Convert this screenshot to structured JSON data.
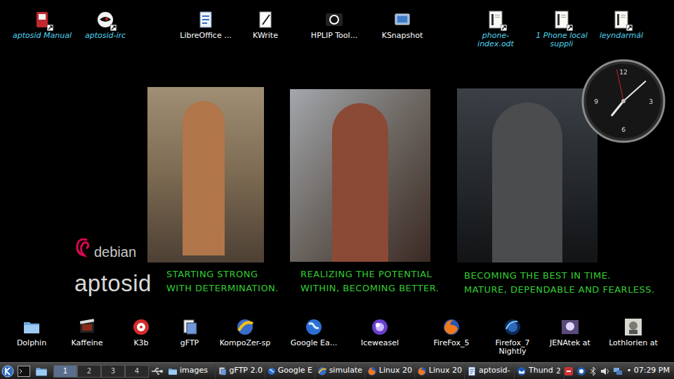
{
  "desktop_icons_top": [
    {
      "label": "aptosid Manual",
      "link": true
    },
    {
      "label": "aptosid-irc",
      "link": true
    },
    {
      "label": "LibreOffice ...",
      "link": false
    },
    {
      "label": "KWrite",
      "link": false
    },
    {
      "label": "HPLIP Tool...",
      "link": false
    },
    {
      "label": "KSnapshot",
      "link": false
    },
    {
      "label": "phone-index.odt",
      "link": true
    },
    {
      "label": "1 Phone local suppli",
      "link": true
    },
    {
      "label": "leyndarmál",
      "link": true
    }
  ],
  "photos": [
    {
      "caption": [
        "STARTING STRONG",
        "WITH DETERMINATION."
      ]
    },
    {
      "caption": [
        "REALIZING THE POTENTIAL",
        "WITHIN, BECOMING BETTER."
      ]
    },
    {
      "caption": [
        "BECOMING THE BEST IN TIME.",
        "MATURE, DEPENDABLE AND FEARLESS."
      ]
    }
  ],
  "logo": {
    "debian": "debian",
    "aptosid": "aptosid"
  },
  "clock": {
    "numerals": [
      "12",
      "3",
      "6",
      "9"
    ],
    "hour": 7.3,
    "minute": 8,
    "second": 58
  },
  "desktop_icons_bottom": [
    {
      "label": "Dolphin"
    },
    {
      "label": "Kaffeine"
    },
    {
      "label": "K3b"
    },
    {
      "label": "gFTP"
    },
    {
      "label": "KompoZer-sp"
    },
    {
      "label": "Google Ea..."
    },
    {
      "label": "Iceweasel"
    },
    {
      "label": "FireFox_5"
    },
    {
      "label": "Firefox_7 Nightly"
    },
    {
      "label": "JENAtek at"
    },
    {
      "label": "Lothlorien at"
    }
  ],
  "taskbar": {
    "pager": [
      {
        "label": "1",
        "selected": true
      },
      {
        "label": "2",
        "selected": false
      },
      {
        "label": "3",
        "selected": false
      },
      {
        "label": "4",
        "selected": false
      }
    ],
    "tasks": [
      {
        "label": "images"
      },
      {
        "label": "gFTP 2.0"
      },
      {
        "label": "Google E"
      },
      {
        "label": "simulate"
      },
      {
        "label": "Linux 20"
      },
      {
        "label": "Linux 20"
      },
      {
        "label": "aptosid-"
      },
      {
        "label": "Thund"
      }
    ],
    "tray": {
      "notifications": "2",
      "time": "07:29 PM"
    }
  }
}
